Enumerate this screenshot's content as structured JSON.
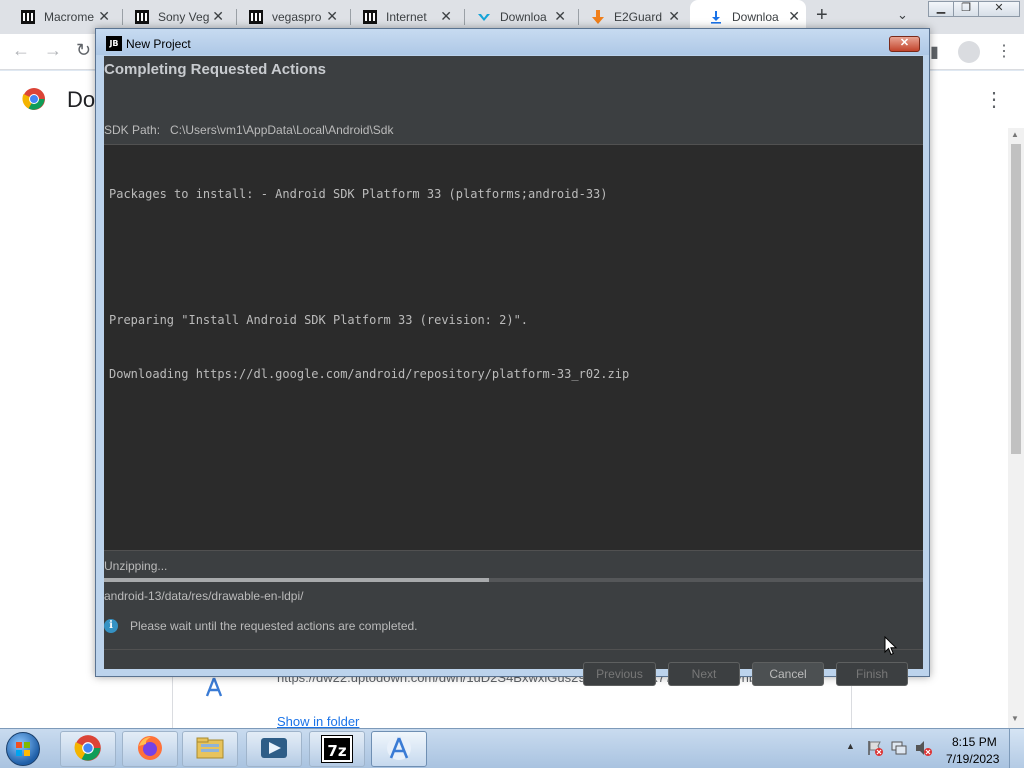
{
  "browser": {
    "tabs": [
      {
        "title": "Macrome",
        "icon": "museum-icon",
        "active": false
      },
      {
        "title": "Sony Veg",
        "icon": "museum-icon",
        "active": false
      },
      {
        "title": "vegaspro",
        "icon": "museum-icon",
        "active": false
      },
      {
        "title": "Internet",
        "icon": "museum-icon",
        "active": false
      },
      {
        "title": "Downloa",
        "icon": "uptodown-icon",
        "active": false
      },
      {
        "title": "E2Guard",
        "icon": "download-arrow-icon",
        "active": false
      },
      {
        "title": "Downloa",
        "icon": "download-icon",
        "active": true
      }
    ],
    "new_tab_glyph": "+",
    "page_title": "Do",
    "download_url": "https://dw22.uptodown.com/dwn/1uD2S4BxwxlGus298JdrLJBBNx77n5uqwWtKvhb...",
    "show_in_folder": "Show in folder"
  },
  "dialog": {
    "title": "New Project",
    "header": "Completing Requested Actions",
    "sdk_path_label": "SDK Path:",
    "sdk_path_value": "C:\\Users\\vm1\\AppData\\Local\\Android\\Sdk",
    "log_lines": [
      "Packages to install: - Android SDK Platform 33 (platforms;android-33)",
      "",
      "Preparing \"Install Android SDK Platform 33 (revision: 2)\".",
      "Downloading https://dl.google.com/android/repository/platform-33_r02.zip"
    ],
    "progress_label": "Unzipping...",
    "progress_fraction": 0.47,
    "progress_detail": "android-13/data/res/drawable-en-ldpi/",
    "info_message": "Please wait until the requested actions are completed.",
    "buttons": {
      "previous": "Previous",
      "next": "Next",
      "cancel": "Cancel",
      "finish": "Finish"
    }
  },
  "taskbar": {
    "apps": [
      "chrome-icon",
      "firefox-icon",
      "file-explorer-icon",
      "media-player-icon",
      "7zip-icon",
      "android-studio-icon"
    ],
    "clock_time": "8:15 PM",
    "clock_date": "7/19/2023",
    "seven_zip_label": "7z"
  }
}
